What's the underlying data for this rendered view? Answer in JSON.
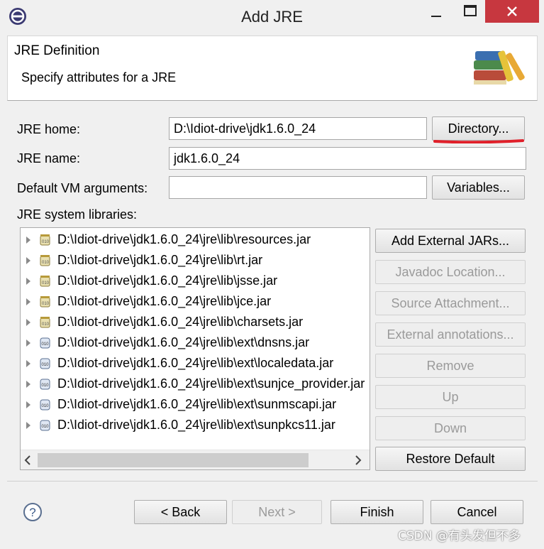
{
  "window": {
    "title": "Add JRE"
  },
  "header": {
    "title": "JRE Definition",
    "description": "Specify attributes for a JRE"
  },
  "form": {
    "jre_home_label": "JRE home:",
    "jre_home_value": "D:\\Idiot-drive\\jdk1.6.0_24",
    "directory_button": "Directory...",
    "jre_name_label": "JRE name:",
    "jre_name_value": "jdk1.6.0_24",
    "vm_args_label": "Default VM arguments:",
    "vm_args_value": "",
    "variables_button": "Variables...",
    "libraries_label": "JRE system libraries:"
  },
  "libraries": [
    "D:\\Idiot-drive\\jdk1.6.0_24\\jre\\lib\\resources.jar",
    "D:\\Idiot-drive\\jdk1.6.0_24\\jre\\lib\\rt.jar",
    "D:\\Idiot-drive\\jdk1.6.0_24\\jre\\lib\\jsse.jar",
    "D:\\Idiot-drive\\jdk1.6.0_24\\jre\\lib\\jce.jar",
    "D:\\Idiot-drive\\jdk1.6.0_24\\jre\\lib\\charsets.jar",
    "D:\\Idiot-drive\\jdk1.6.0_24\\jre\\lib\\ext\\dnsns.jar",
    "D:\\Idiot-drive\\jdk1.6.0_24\\jre\\lib\\ext\\localedata.jar",
    "D:\\Idiot-drive\\jdk1.6.0_24\\jre\\lib\\ext\\sunjce_provider.jar",
    "D:\\Idiot-drive\\jdk1.6.0_24\\jre\\lib\\ext\\sunmscapi.jar",
    "D:\\Idiot-drive\\jdk1.6.0_24\\jre\\lib\\ext\\sunpkcs11.jar"
  ],
  "library_buttons": {
    "add_external_jars": "Add External JARs...",
    "javadoc_location": "Javadoc Location...",
    "source_attachment": "Source Attachment...",
    "external_annotations": "External annotations...",
    "remove": "Remove",
    "up": "Up",
    "down": "Down",
    "restore_default": "Restore Default"
  },
  "footer": {
    "help_icon": "?",
    "back": "< Back",
    "next": "Next >",
    "finish": "Finish",
    "cancel": "Cancel"
  },
  "watermark": "CSDN @有头发但不多",
  "colors": {
    "close_button": "#c7373f",
    "annotation_underline": "#e0202a"
  }
}
